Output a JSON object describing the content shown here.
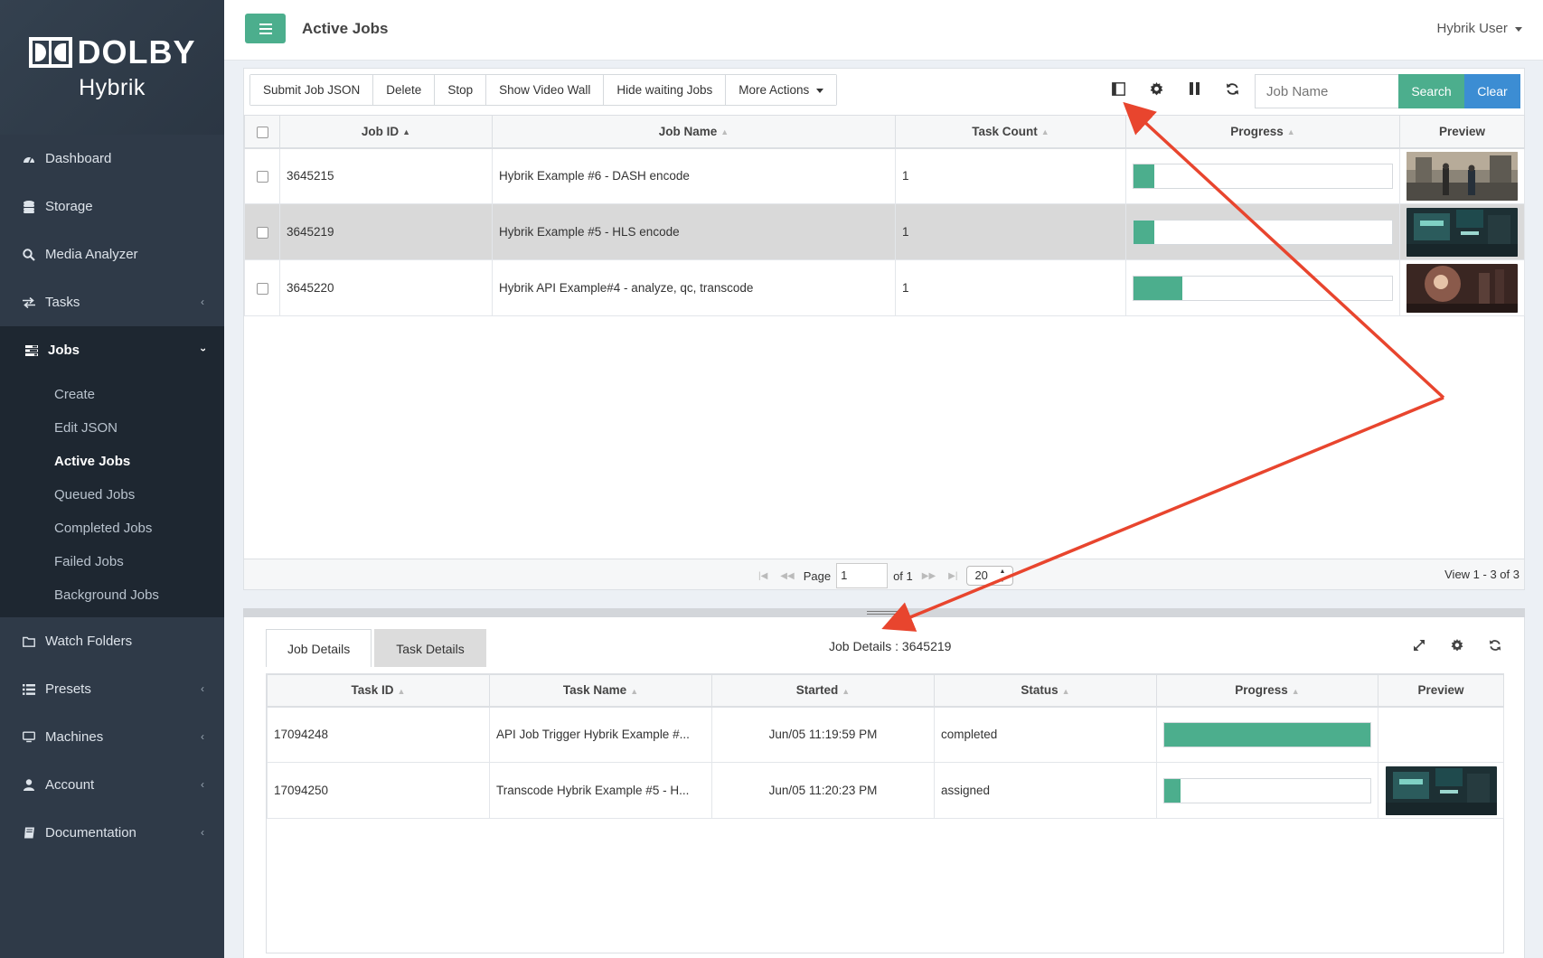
{
  "brand": {
    "logo_text": "DOLBY",
    "product": "Hybrik"
  },
  "sidebar": {
    "items": [
      {
        "label": "Dashboard",
        "icon": "dashboard-icon"
      },
      {
        "label": "Storage",
        "icon": "database-icon"
      },
      {
        "label": "Media Analyzer",
        "icon": "search-icon"
      },
      {
        "label": "Tasks",
        "icon": "exchange-icon"
      },
      {
        "label": "Jobs",
        "icon": "tasks-icon"
      },
      {
        "label": "Watch Folders",
        "icon": "folder-icon"
      },
      {
        "label": "Presets",
        "icon": "list-icon"
      },
      {
        "label": "Machines",
        "icon": "monitor-icon"
      },
      {
        "label": "Account",
        "icon": "user-icon"
      },
      {
        "label": "Documentation",
        "icon": "book-icon"
      }
    ],
    "jobs_submenu": [
      "Create",
      "Edit JSON",
      "Active Jobs",
      "Queued Jobs",
      "Completed Jobs",
      "Failed Jobs",
      "Background Jobs"
    ]
  },
  "header": {
    "title": "Active Jobs",
    "user": "Hybrik User"
  },
  "toolbar": {
    "buttons": [
      "Submit Job JSON",
      "Delete",
      "Stop",
      "Show Video Wall",
      "Hide waiting Jobs",
      "More Actions"
    ],
    "search_placeholder": "Job Name",
    "search_label": "Search",
    "clear_label": "Clear"
  },
  "jobs_table": {
    "columns": [
      "Job ID",
      "Job Name",
      "Task Count",
      "Progress",
      "Preview"
    ],
    "rows": [
      {
        "id": "3645215",
        "name": "Hybrik Example #6 - DASH encode",
        "task_count": "1",
        "progress": 0.08,
        "selected": false
      },
      {
        "id": "3645219",
        "name": "Hybrik Example #5 - HLS encode",
        "task_count": "1",
        "progress": 0.08,
        "selected": true
      },
      {
        "id": "3645220",
        "name": "Hybrik API Example#4 - analyze, qc, transcode",
        "task_count": "1",
        "progress": 0.19,
        "selected": false
      }
    ]
  },
  "pager": {
    "page_label": "Page",
    "page_value": "1",
    "of_label": "of 1",
    "page_size": "20",
    "view_info": "View 1 - 3 of 3"
  },
  "details": {
    "tabs": [
      "Job Details",
      "Task Details"
    ],
    "title": "Job Details : 3645219",
    "columns": [
      "Task ID",
      "Task Name",
      "Started",
      "Status",
      "Progress",
      "Preview"
    ],
    "rows": [
      {
        "id": "17094248",
        "name": "API Job Trigger Hybrik Example #...",
        "started": "Jun/05 11:19:59 PM",
        "status": "completed",
        "progress": 1.0,
        "has_preview": false
      },
      {
        "id": "17094250",
        "name": "Transcode Hybrik Example #5 - H...",
        "started": "Jun/05 11:20:23 PM",
        "status": "assigned",
        "progress": 0.08,
        "has_preview": true
      }
    ]
  },
  "colors": {
    "accent": "#4cae8d",
    "primary": "#3c8dd3",
    "sidebar": "#2f3a48",
    "annotation": "#e8452e"
  }
}
